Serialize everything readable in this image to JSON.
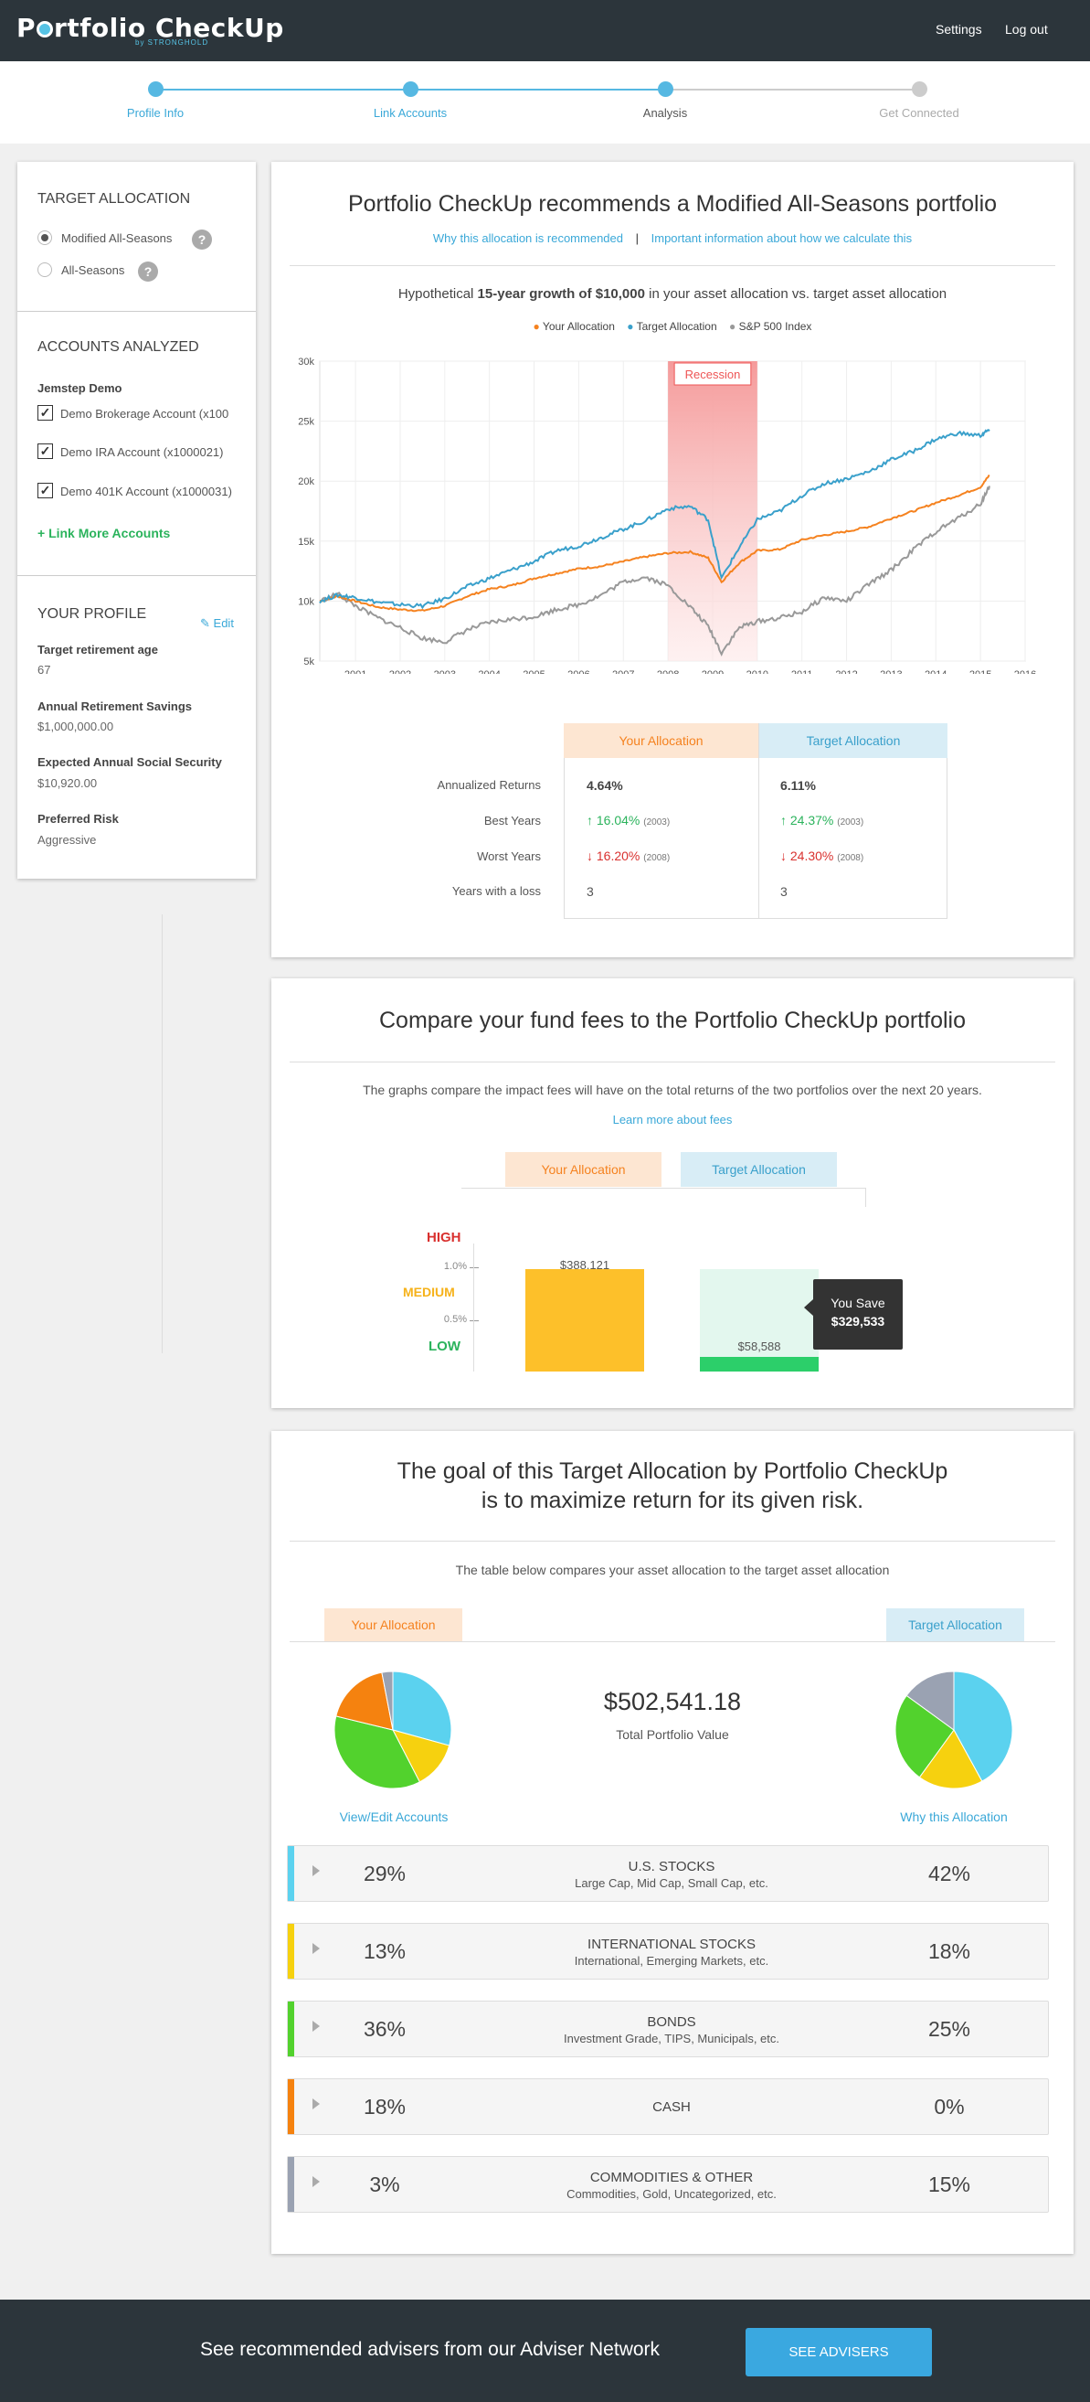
{
  "header": {
    "logo_text": "Portfolio CheckUp",
    "logo_sub": "by STRONGHOLD",
    "settings": "Settings",
    "logout": "Log out"
  },
  "steps": [
    {
      "label": "Profile Info",
      "state": "done"
    },
    {
      "label": "Link Accounts",
      "state": "done"
    },
    {
      "label": "Analysis",
      "state": "current"
    },
    {
      "label": "Get Connected",
      "state": "todo"
    }
  ],
  "sidebar": {
    "target_title": "TARGET ALLOCATION",
    "options": [
      {
        "label": "Modified All-Seasons",
        "selected": true
      },
      {
        "label": "All-Seasons",
        "selected": false
      }
    ],
    "help_glyph": "?",
    "accounts_title": "ACCOUNTS ANALYZED",
    "institution": "Jemstep Demo",
    "accounts": [
      "Demo Brokerage Account (x100",
      "Demo IRA Account (x1000021)",
      "Demo 401K Account (x1000031)"
    ],
    "link_more": "+ Link More Accounts",
    "profile_title": "YOUR PROFILE",
    "edit": "Edit",
    "fields": [
      {
        "label": "Target retirement age",
        "value": "67"
      },
      {
        "label": "Annual Retirement Savings",
        "value": "$1,000,000.00"
      },
      {
        "label": "Expected Annual Social Security",
        "value": "$10,920.00"
      },
      {
        "label": "Preferred Risk",
        "value": "Aggressive"
      }
    ]
  },
  "growth": {
    "title": "Portfolio CheckUp recommends a Modified All-Seasons portfolio",
    "link1": "Why this allocation is recommended",
    "link2": "Important information about how we calculate this",
    "subtitle_pre": "Hypothetical ",
    "subtitle_bold": "15-year growth of $10,000",
    "subtitle_post": " in your asset allocation vs. target asset allocation",
    "legend": [
      {
        "name": "Your Allocation",
        "color": "#f5821f"
      },
      {
        "name": "Target Allocation",
        "color": "#3aa0cb"
      },
      {
        "name": "S&P 500 Index",
        "color": "#999999"
      }
    ],
    "recession_label": "Recession",
    "stats": {
      "col1": "Your Allocation",
      "col2": "Target Allocation",
      "rows": [
        {
          "label": "Annualized Returns",
          "v1": "4.64%",
          "v2": "6.11%"
        },
        {
          "label": "Best Years",
          "v1": "16.04%",
          "y1": "(2003)",
          "v2": "24.37%",
          "y2": "(2003)"
        },
        {
          "label": "Worst Years",
          "v1": "16.20%",
          "y1": "(2008)",
          "v2": "24.30%",
          "y2": "(2008)"
        },
        {
          "label": "Years with a loss",
          "v1": "3",
          "v2": "3"
        }
      ]
    }
  },
  "chart_data": {
    "type": "line",
    "x_label": "year",
    "ylim": [
      5000,
      30000
    ],
    "xlim": [
      2000.2,
      2016
    ],
    "y_ticks": [
      "5k",
      "10k",
      "15k",
      "20k",
      "25k",
      "30k"
    ],
    "x_ticks": [
      "2001",
      "2002",
      "2003",
      "2004",
      "2005",
      "2006",
      "2007",
      "2008",
      "2009",
      "2010",
      "2011",
      "2012",
      "2013",
      "2014",
      "2015",
      "2016"
    ],
    "recession": [
      2008,
      2010
    ],
    "grid": true,
    "series": [
      {
        "name": "Your Allocation",
        "color": "#f5821f",
        "x": [
          2000.2,
          2000.6,
          2001,
          2001.5,
          2002,
          2002.5,
          2003,
          2003.5,
          2004,
          2004.5,
          2005,
          2005.5,
          2006,
          2006.5,
          2007,
          2007.5,
          2008,
          2008.5,
          2008.9,
          2009.2,
          2009.6,
          2010,
          2010.5,
          2011,
          2011.5,
          2012,
          2012.5,
          2013,
          2013.5,
          2014,
          2014.5,
          2015,
          2015.2
        ],
        "y": [
          10000,
          10400,
          10000,
          9500,
          9300,
          9200,
          9600,
          10400,
          11000,
          11300,
          11900,
          12300,
          12700,
          12900,
          13300,
          13700,
          14000,
          14100,
          13600,
          11600,
          13200,
          14200,
          14300,
          15100,
          15500,
          15800,
          16200,
          16900,
          17500,
          18200,
          18800,
          19500,
          20500
        ]
      },
      {
        "name": "Target Allocation",
        "color": "#3aa0cb",
        "x": [
          2000.2,
          2000.6,
          2001,
          2001.5,
          2002,
          2002.5,
          2003,
          2003.5,
          2004,
          2004.5,
          2005,
          2005.5,
          2006,
          2006.5,
          2007,
          2007.5,
          2008,
          2008.5,
          2008.9,
          2009.2,
          2009.6,
          2010,
          2010.5,
          2011,
          2011.5,
          2012,
          2012.5,
          2013,
          2013.5,
          2014,
          2014.5,
          2015,
          2015.2
        ],
        "y": [
          10000,
          10500,
          10300,
          9900,
          9700,
          9600,
          10200,
          11200,
          11900,
          12600,
          13300,
          14200,
          14600,
          15300,
          16000,
          16700,
          17700,
          17900,
          16800,
          11900,
          14500,
          16800,
          17500,
          18800,
          19800,
          20200,
          20800,
          21800,
          22500,
          23500,
          24000,
          23800,
          24300
        ]
      },
      {
        "name": "S&P 500 Index",
        "color": "#999999",
        "x": [
          2000.2,
          2000.6,
          2001,
          2001.5,
          2002,
          2002.5,
          2003,
          2003.5,
          2004,
          2004.5,
          2005,
          2005.5,
          2006,
          2006.5,
          2007,
          2007.5,
          2008,
          2008.5,
          2008.9,
          2009.2,
          2009.6,
          2010,
          2010.5,
          2011,
          2011.5,
          2012,
          2012.5,
          2013,
          2013.5,
          2014,
          2014.5,
          2015,
          2015.2
        ],
        "y": [
          10000,
          10600,
          9600,
          8600,
          7800,
          6900,
          6600,
          7600,
          8200,
          8500,
          8700,
          9300,
          9700,
          10500,
          11600,
          12000,
          11300,
          9500,
          7900,
          5700,
          7800,
          8300,
          8600,
          9100,
          10300,
          10000,
          11400,
          12600,
          14300,
          15800,
          16900,
          18100,
          19600
        ]
      }
    ]
  },
  "fees": {
    "title": "Compare your fund fees to the Portfolio CheckUp portfolio",
    "desc": "The graphs compare the impact fees will have on the total returns of the two portfolios over the next 20 years.",
    "link": "Learn more about fees",
    "tab1": "Your Allocation",
    "tab2": "Target Allocation",
    "levels": [
      {
        "label": "HIGH",
        "color": "#d9312f"
      },
      {
        "label": "MEDIUM",
        "color": "#f6b21b"
      },
      {
        "label": "LOW",
        "color": "#2bb35c"
      }
    ],
    "ticks": [
      "1.0%",
      "0.5%"
    ],
    "bar1_value": "$388,121",
    "bar2_value": "$58,588",
    "tooltip_l1": "You Save",
    "tooltip_l2": "$329,533",
    "bar1_fraction": 1.0,
    "bar2_fraction": 0.15
  },
  "goal": {
    "title_l1": "The goal of this Target Allocation by Portfolio CheckUp",
    "title_l2": "is to maximize return for its given risk.",
    "desc": "The table below compares your asset allocation to the target asset allocation",
    "tab1": "Your Allocation",
    "tab2": "Target Allocation",
    "total_value": "$502,541.18",
    "total_label": "Total Portfolio Value",
    "link1": "View/Edit Accounts",
    "link2": "Why this Allocation",
    "your_pie": [
      {
        "name": "U.S. STOCKS",
        "value": 29,
        "color": "#5bd2ef"
      },
      {
        "name": "INTERNATIONAL STOCKS",
        "value": 13,
        "color": "#f6d10f"
      },
      {
        "name": "BONDS",
        "value": 36,
        "color": "#52d22d"
      },
      {
        "name": "CASH",
        "value": 18,
        "color": "#f5820f"
      },
      {
        "name": "COMMODITIES & OTHER",
        "value": 3,
        "color": "#9aa2b2"
      }
    ],
    "target_pie": [
      {
        "name": "U.S. STOCKS",
        "value": 42,
        "color": "#5bd2ef"
      },
      {
        "name": "INTERNATIONAL STOCKS",
        "value": 18,
        "color": "#f6d10f"
      },
      {
        "name": "BONDS",
        "value": 25,
        "color": "#52d22d"
      },
      {
        "name": "CASH",
        "value": 0,
        "color": "#f5820f"
      },
      {
        "name": "COMMODITIES & OTHER",
        "value": 15,
        "color": "#9aa2b2"
      }
    ],
    "rows": [
      {
        "your": "29%",
        "name": "U.S. STOCKS",
        "desc": "Large Cap, Mid Cap, Small Cap, etc.",
        "target": "42%",
        "color": "#5bd2ef"
      },
      {
        "your": "13%",
        "name": "INTERNATIONAL STOCKS",
        "desc": "International, Emerging Markets, etc.",
        "target": "18%",
        "color": "#f6d10f"
      },
      {
        "your": "36%",
        "name": "BONDS",
        "desc": "Investment Grade, TIPS, Municipals, etc.",
        "target": "25%",
        "color": "#52d22d"
      },
      {
        "your": "18%",
        "name": "CASH",
        "desc": "",
        "target": "0%",
        "color": "#f5820f"
      },
      {
        "your": "3%",
        "name": "COMMODITIES & OTHER",
        "desc": "Commodities, Gold, Uncategorized, etc.",
        "target": "15%",
        "color": "#9aa2b2"
      }
    ]
  },
  "footer": {
    "text": "See recommended advisers from our Adviser Network",
    "button": "SEE ADVISERS"
  }
}
